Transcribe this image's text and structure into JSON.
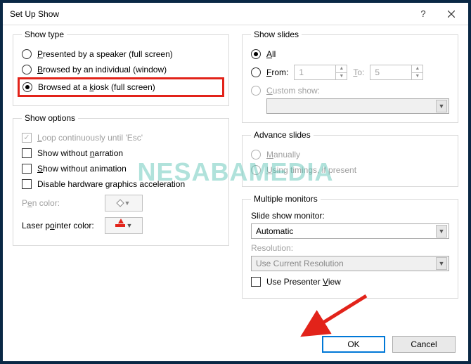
{
  "titlebar": {
    "title": "Set Up Show"
  },
  "show_type": {
    "legend": "Show type",
    "options": [
      {
        "label_pre": "",
        "accel": "P",
        "label_post": "resented by a speaker (full screen)"
      },
      {
        "label_pre": "",
        "accel": "B",
        "label_post": "rowsed by an individual (window)"
      },
      {
        "label_pre": "Browsed at a ",
        "accel": "k",
        "label_post": "iosk (full screen)"
      }
    ]
  },
  "show_options": {
    "legend": "Show options",
    "loop": {
      "pre": "",
      "accel": "L",
      "post": "oop continuously until 'Esc'"
    },
    "no_narration": {
      "pre": "Show without ",
      "accel": "n",
      "post": "arration"
    },
    "no_animation": {
      "pre": "",
      "accel": "S",
      "post": "how without animation"
    },
    "disable_hw": {
      "pre": "Disable hardware ",
      "accel": "g",
      "post": "raphics acceleration"
    },
    "pen_label": {
      "pre": "P",
      "accel": "e",
      "post": "n color:"
    },
    "laser_label": {
      "pre": "Laser p",
      "accel": "o",
      "post": "inter color:"
    }
  },
  "show_slides": {
    "legend": "Show slides",
    "all": {
      "accel": "A",
      "post": "ll"
    },
    "from": {
      "accel": "F",
      "post": "rom:"
    },
    "from_value": "1",
    "to_label": {
      "accel": "T",
      "post": "o:"
    },
    "to_value": "5",
    "custom": {
      "accel": "C",
      "post": "ustom show:"
    }
  },
  "advance": {
    "legend": "Advance slides",
    "manual": {
      "accel": "M",
      "post": "anually"
    },
    "timings": {
      "accel": "U",
      "post": "sing timings, if present"
    }
  },
  "monitors": {
    "legend": "Multiple monitors",
    "monitor_label": "Slide show monitor:",
    "monitor_value": "Automatic",
    "resolution_label": "Resolution:",
    "resolution_value": "Use Current Resolution",
    "presenter": {
      "pre": "Use Presenter ",
      "accel": "V",
      "post": "iew"
    }
  },
  "footer": {
    "ok": "OK",
    "cancel": "Cancel"
  },
  "watermark": "NESABAMEDIA"
}
